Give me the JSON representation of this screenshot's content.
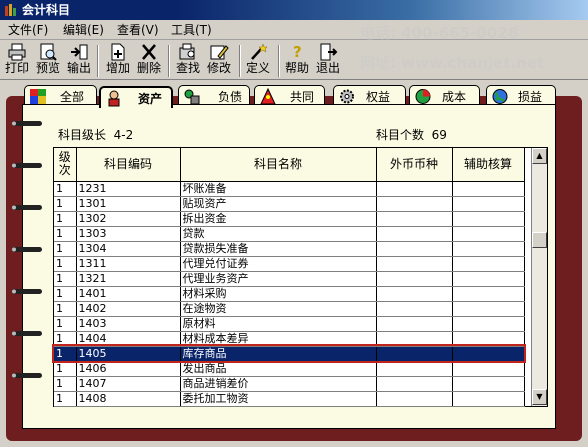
{
  "window": {
    "title": "会计科目"
  },
  "menu": [
    "文件(F)",
    "编辑(E)",
    "查看(V)",
    "工具(T)"
  ],
  "toolbar": [
    {
      "label": "打印",
      "icon": "printer-icon"
    },
    {
      "label": "预览",
      "icon": "preview-icon"
    },
    {
      "label": "输出",
      "icon": "export-icon"
    },
    {
      "label": "增加",
      "icon": "add-doc-icon"
    },
    {
      "label": "删除",
      "icon": "delete-x-icon"
    },
    {
      "label": "查找",
      "icon": "find-icon"
    },
    {
      "label": "修改",
      "icon": "edit-icon"
    },
    {
      "label": "定义",
      "icon": "magic-wand-icon"
    },
    {
      "label": "帮助",
      "icon": "help-icon"
    },
    {
      "label": "退出",
      "icon": "exit-icon"
    }
  ],
  "tabs": [
    {
      "label": "全部",
      "icon": "all-blocks-icon"
    },
    {
      "label": "资产",
      "icon": "asset-worker-icon",
      "active": true
    },
    {
      "label": "负债",
      "icon": "liability-icon"
    },
    {
      "label": "共同",
      "icon": "common-icon"
    },
    {
      "label": "权益",
      "icon": "equity-gear-icon"
    },
    {
      "label": "成本",
      "icon": "cost-pie-icon"
    },
    {
      "label": "损益",
      "icon": "profit-globe-icon"
    }
  ],
  "info": {
    "level_label": "科目级长",
    "level_value": "4-2",
    "count_label": "科目个数",
    "count_value": "69"
  },
  "table": {
    "headers": [
      "级次",
      "科目编码",
      "科目名称",
      "外币币种",
      "辅助核算"
    ],
    "rows": [
      [
        "1",
        "1231",
        "坏账准备",
        "",
        ""
      ],
      [
        "1",
        "1301",
        "贴现资产",
        "",
        ""
      ],
      [
        "1",
        "1302",
        "拆出资金",
        "",
        ""
      ],
      [
        "1",
        "1303",
        "贷款",
        "",
        ""
      ],
      [
        "1",
        "1304",
        "贷款损失准备",
        "",
        ""
      ],
      [
        "1",
        "1311",
        "代理兑付证券",
        "",
        ""
      ],
      [
        "1",
        "1321",
        "代理业务资产",
        "",
        ""
      ],
      [
        "1",
        "1401",
        "材料采购",
        "",
        ""
      ],
      [
        "1",
        "1402",
        "在途物资",
        "",
        ""
      ],
      [
        "1",
        "1403",
        "原材料",
        "",
        ""
      ],
      [
        "1",
        "1404",
        "材料成本差异",
        "",
        ""
      ],
      [
        "1",
        "1405",
        "库存商品",
        "",
        ""
      ],
      [
        "1",
        "1406",
        "发出商品",
        "",
        ""
      ],
      [
        "1",
        "1407",
        "商品进销差价",
        "",
        ""
      ],
      [
        "1",
        "1408",
        "委托加工物资",
        "",
        ""
      ]
    ],
    "selected_index": 11
  },
  "watermark": {
    "phone": "电话: 400-665-0028",
    "site": "网址: www.chanjet.net"
  },
  "colors": {
    "title_bar": "#0a246a",
    "selection": "#0a246a",
    "selection_border": "#c0241c",
    "book_cover": "#6e1e1e",
    "paper": "#fbfbe3"
  }
}
